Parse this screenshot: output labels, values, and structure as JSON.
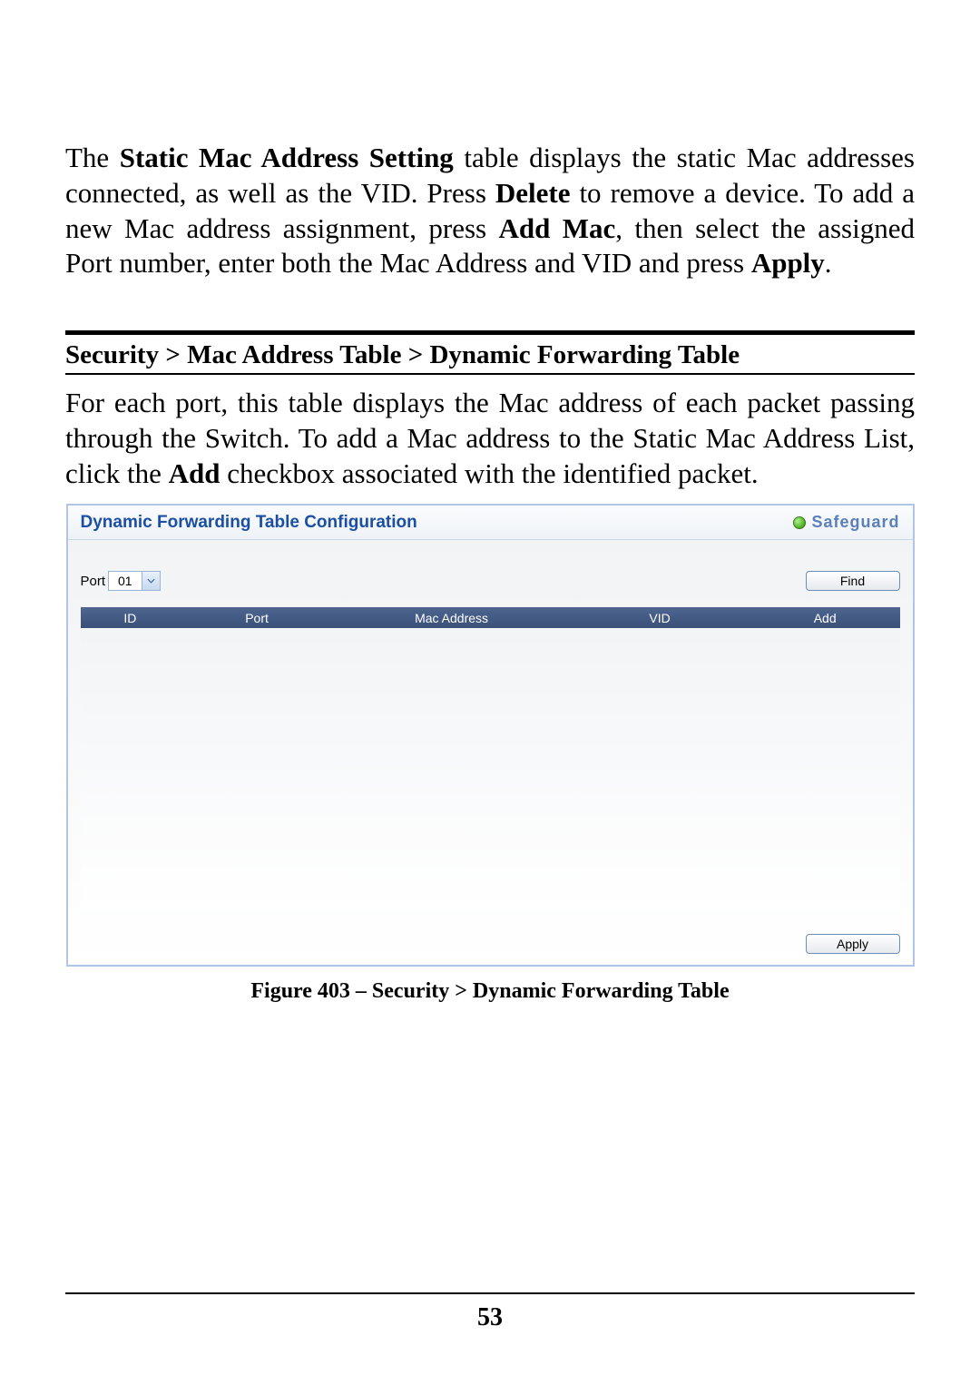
{
  "paragraph1": {
    "part1": "The ",
    "bold1": "Static Mac Address Setting",
    "part2": " table displays the static Mac addresses connected, as well as the VID. Press ",
    "bold2": "Delete",
    "part3": " to remove a device. To add a new Mac address assignment, press ",
    "bold3": "Add Mac",
    "part4": ", then select the assigned Port number, enter both the Mac Address and VID and press ",
    "bold4": "Apply",
    "part5": "."
  },
  "heading": "Security > Mac Address Table > Dynamic Forwarding Table",
  "paragraph2": {
    "part1": "For each port, this table displays the Mac address of each packet passing through the Switch. To add a Mac address to the Static Mac Address List, click the ",
    "bold1": "Add",
    "part2": " checkbox associated with the identified packet."
  },
  "panel": {
    "title": "Dynamic Forwarding Table Configuration",
    "safeguard": "Safeguard",
    "portLabel": "Port",
    "portValue": "01",
    "findButton": "Find",
    "applyButton": "Apply",
    "columns": {
      "id": "ID",
      "port": "Port",
      "mac": "Mac Address",
      "vid": "VID",
      "add": "Add"
    }
  },
  "figureCaption": "Figure 403 – Security > Dynamic Forwarding Table",
  "pageNumber": "53"
}
